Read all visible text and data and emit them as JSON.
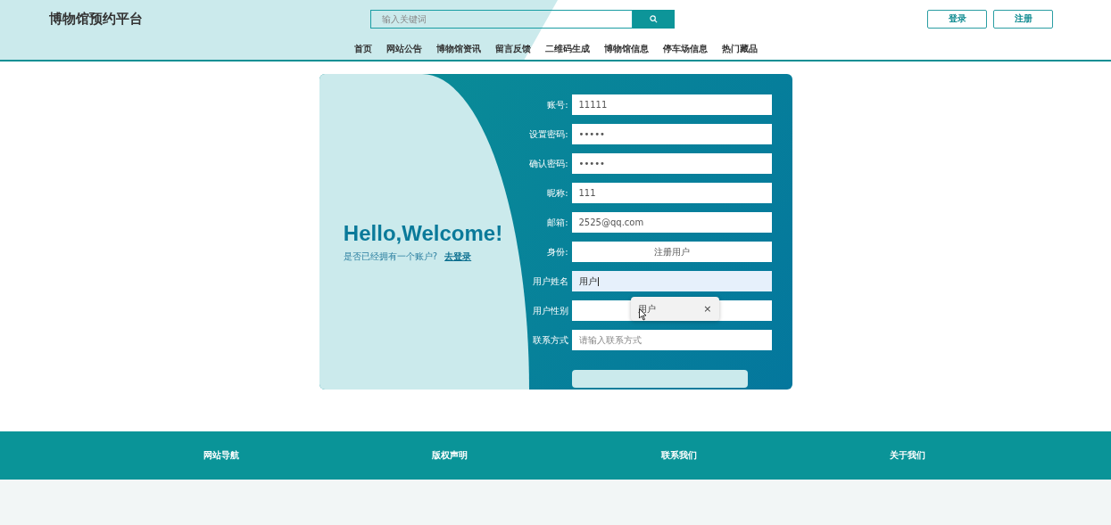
{
  "header": {
    "title": "博物馆预约平台",
    "search": {
      "placeholder": "输入关键词"
    },
    "buttons": [
      "登录",
      "注册"
    ]
  },
  "nav": [
    "首页",
    "网站公告",
    "博物馆资讯",
    "留言反馈",
    "二维码生成",
    "博物馆信息",
    "停车场信息",
    "热门藏品"
  ],
  "welcome": {
    "heading": "Hello,Welcome!",
    "prompt": "是否已经拥有一个账户?",
    "link": "去登录"
  },
  "form": {
    "fields": [
      {
        "label": "账号:",
        "kind": "input",
        "value": "11111",
        "focused": false
      },
      {
        "label": "设置密码:",
        "kind": "input",
        "value": "•••••",
        "focused": false
      },
      {
        "label": "确认密码:",
        "kind": "input",
        "value": "•••••",
        "focused": false
      },
      {
        "label": "昵称:",
        "kind": "input",
        "value": "111",
        "focused": false
      },
      {
        "label": "邮箱:",
        "kind": "input",
        "value": "2525@qq.com",
        "focused": false
      },
      {
        "label": "身份:",
        "kind": "select",
        "value": "注册用户",
        "focused": false
      },
      {
        "label": "用户姓名",
        "kind": "input",
        "value": "用户",
        "focused": true
      },
      {
        "label": "用户性别",
        "kind": "input",
        "focused": false
      },
      {
        "label": "联系方式",
        "kind": "input",
        "placeholder": "请输入联系方式",
        "focused": false
      }
    ],
    "autocomplete": {
      "suggestion": "用户",
      "close": "×"
    }
  },
  "footer": [
    "网站导航",
    "版权声明",
    "联系我们",
    "关于我们"
  ]
}
